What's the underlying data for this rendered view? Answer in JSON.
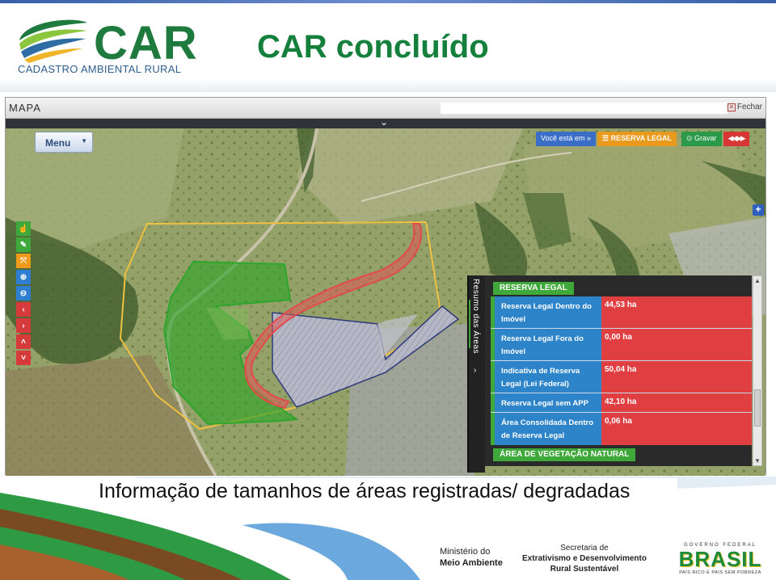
{
  "logo": {
    "name": "CAR",
    "subtitle": "CADASTRO AMBIENTAL RURAL"
  },
  "slide_title": "CAR concluído",
  "map_window": {
    "title": "MAPA",
    "close_label": "Fechar",
    "menu_label": "Menu",
    "breadcrumb_label": "Você está em »",
    "breadcrumb_current": "RESERVA LEGAL",
    "save_label": "Gravar",
    "nav_label": "◀◀ ▶▶"
  },
  "summary_panel": {
    "tab_label": "Resumo das Áreas",
    "section_title": "RESERVA LEGAL",
    "rows": [
      {
        "label": "Reserva Legal Dentro do Imóvel",
        "value": "44,53 ha"
      },
      {
        "label": "Reserva Legal Fora do Imóvel",
        "value": "0,00 ha"
      },
      {
        "label": "Indicativa de Reserva Legal (Lei Federal)",
        "value": "50,04 ha"
      },
      {
        "label": "Reserva Legal sem APP",
        "value": "42,10 ha"
      },
      {
        "label": "Área Consolidada Dentro de Reserva Legal",
        "value": "0,06 ha"
      }
    ],
    "next_section_title": "ÁREA DE VEGETAÇÃO NATURAL"
  },
  "caption": "Informação de tamanhos de áreas registradas/ degradadas",
  "footer": {
    "ministry_line1": "Ministério do",
    "ministry_line2": "Meio Ambiente",
    "secretaria_line1": "Secretaria de",
    "secretaria_line2": "Extrativismo e Desenvolvimento",
    "secretaria_line3": "Rural Sustentável",
    "gov_top": "GOVERNO FEDERAL",
    "gov_name": "BRASIL",
    "gov_slogan": "PAÍS RICO É PAÍS SEM POBREZA"
  },
  "colors": {
    "brand_green": "#14803c",
    "row_blue": "#2e84c8",
    "value_red": "#e03f42",
    "section_green": "#3ea83a"
  }
}
